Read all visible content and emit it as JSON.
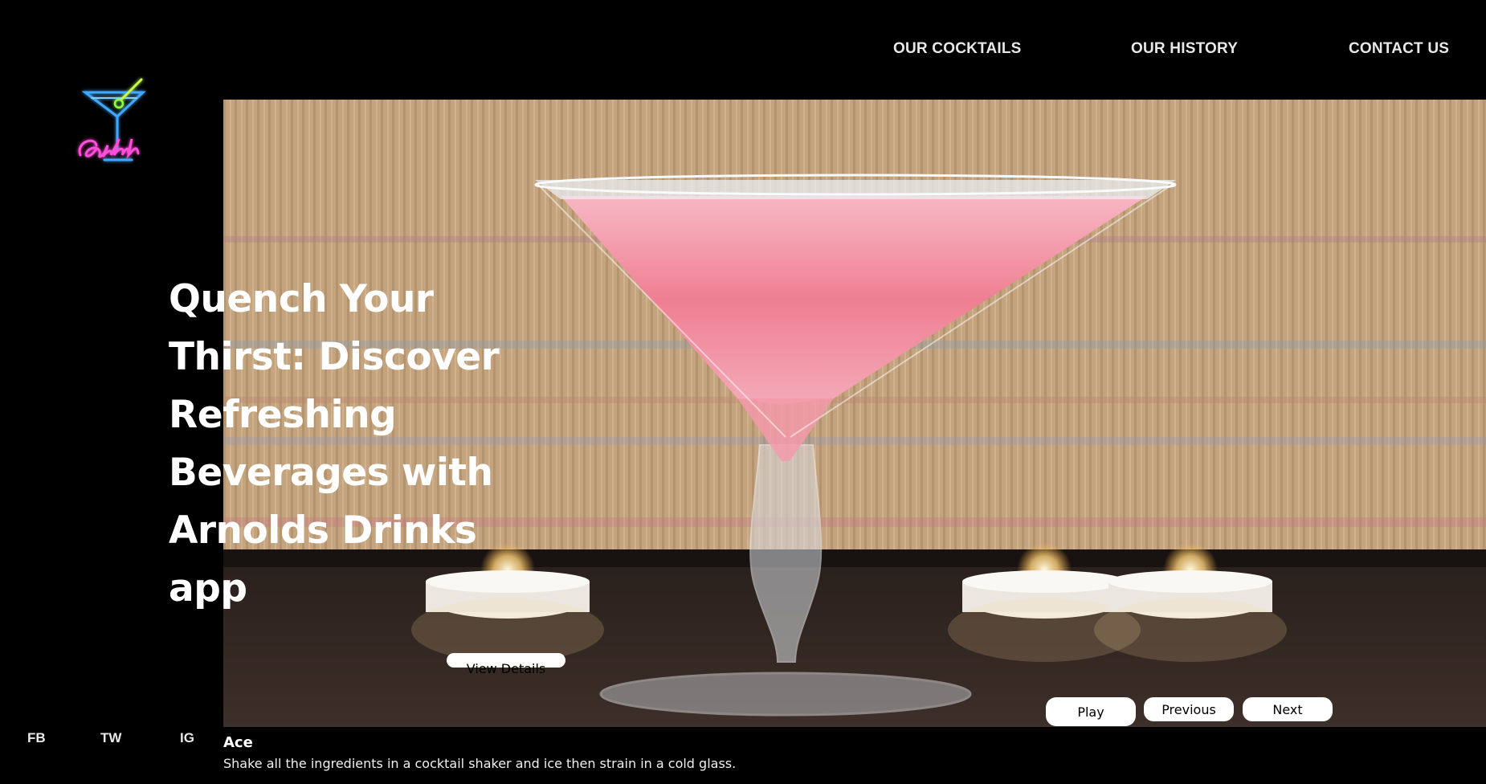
{
  "nav": {
    "items": [
      {
        "label": "OUR COCKTAILS"
      },
      {
        "label": "OUR HISTORY"
      },
      {
        "label": "CONTACT US"
      }
    ]
  },
  "logo": {
    "text": "Cocktails"
  },
  "hero": {
    "headline": "Quench Your Thirst: Discover Refreshing Beverages with Arnolds Drinks app",
    "details_button": "View Details"
  },
  "carousel": {
    "play_label": "Play",
    "previous_label": "Previous",
    "next_label": "Next"
  },
  "social": [
    {
      "label": "FB"
    },
    {
      "label": "TW"
    },
    {
      "label": "IG"
    }
  ],
  "caption": {
    "title": "Ace",
    "text": "Shake all the ingredients in a cocktail shaker and ice then strain in a cold glass."
  },
  "colors": {
    "background": "#000000",
    "text": "#ffffff",
    "neon_pink": "#ff4fd8",
    "neon_blue": "#4fb3ff"
  }
}
